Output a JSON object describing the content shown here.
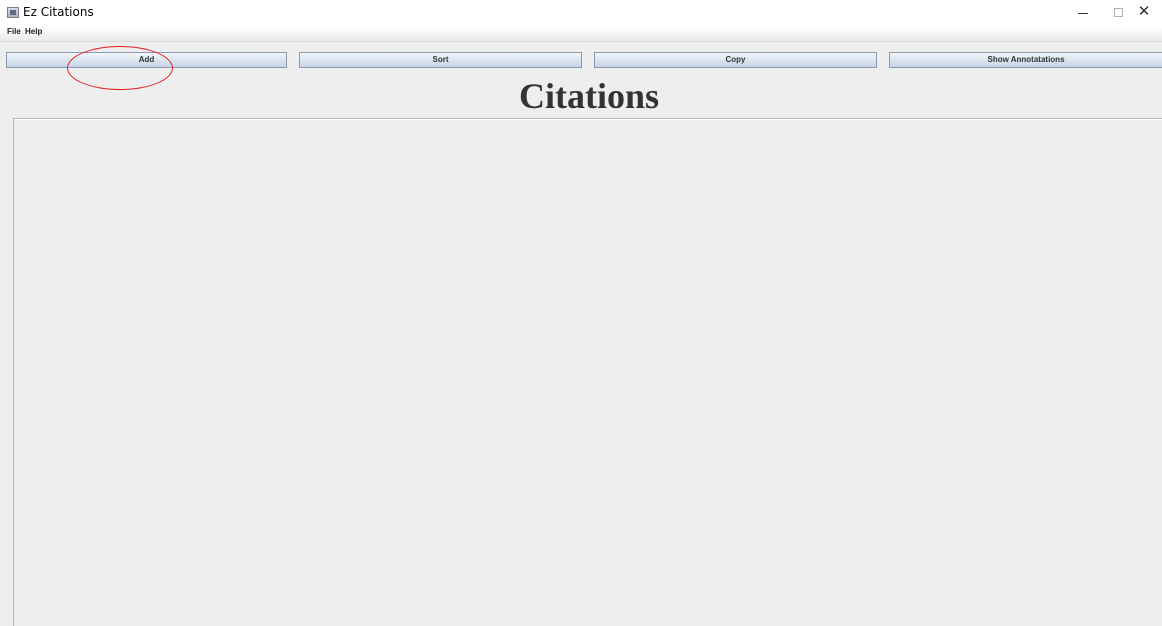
{
  "window": {
    "title": "Ez Citations",
    "controls": {
      "minimize_icon": "minimize-icon",
      "maximize_icon": "maximize-icon",
      "close_symbol": "✕"
    }
  },
  "menubar": {
    "items": [
      "File",
      "Help"
    ]
  },
  "toolbar": {
    "add_label": "Add",
    "sort_label": "Sort",
    "copy_label": "Copy",
    "show_label": "Show Annotatations"
  },
  "main": {
    "heading": "Citations"
  },
  "colors": {
    "annotation_circle": "#e02020",
    "background": "#eeeeee",
    "heading_text": "#333333"
  }
}
